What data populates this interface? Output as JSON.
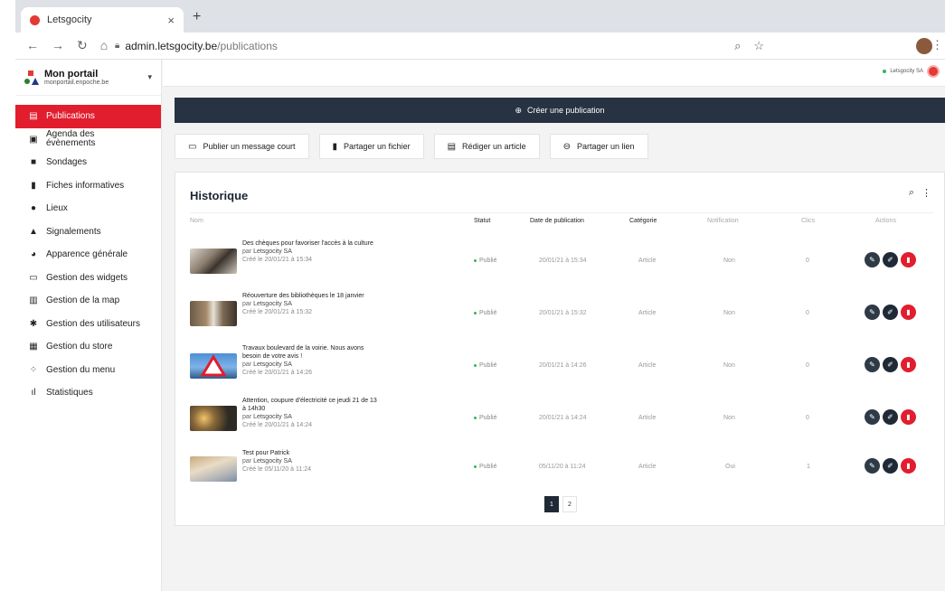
{
  "browser": {
    "tab_title": "Letsgocity",
    "tab_close": "×",
    "new_tab": "+",
    "url_host": "admin.letsgocity.be",
    "url_path": "/publications"
  },
  "portal": {
    "name": "Mon portail",
    "domain": "monportail.enpoche.be"
  },
  "account": {
    "name": "Letsgocity SA"
  },
  "sidebar": {
    "items": [
      {
        "label": "Publications",
        "icon": "list-icon"
      },
      {
        "label": "Agenda des évènements",
        "icon": "calendar-icon"
      },
      {
        "label": "Sondages",
        "icon": "chart-icon"
      },
      {
        "label": "Fiches informatives",
        "icon": "file-icon"
      },
      {
        "label": "Lieux",
        "icon": "pin-icon"
      },
      {
        "label": "Signalements",
        "icon": "warning-icon"
      },
      {
        "label": "Apparence générale",
        "icon": "palette-icon"
      },
      {
        "label": "Gestion des widgets",
        "icon": "widget-icon"
      },
      {
        "label": "Gestion de la map",
        "icon": "map-icon"
      },
      {
        "label": "Gestion des utilisateurs",
        "icon": "gear-icon"
      },
      {
        "label": "Gestion du store",
        "icon": "store-icon"
      },
      {
        "label": "Gestion du menu",
        "icon": "grid-icon"
      },
      {
        "label": "Statistiques",
        "icon": "bars-icon"
      }
    ]
  },
  "main": {
    "create_label": "Créer une publication",
    "actions": [
      {
        "label": "Publier un message court",
        "icon": "message-icon"
      },
      {
        "label": "Partager un fichier",
        "icon": "file-icon"
      },
      {
        "label": "Rédiger un article",
        "icon": "article-icon"
      },
      {
        "label": "Partager un lien",
        "icon": "link-icon"
      }
    ]
  },
  "history": {
    "title": "Historique",
    "columns": {
      "name": "Nom",
      "status": "Statut",
      "date": "Date de publication",
      "category": "Catégorie",
      "notification": "Notification",
      "clicks": "Clics",
      "actions": "Actions"
    },
    "rows": [
      {
        "title": "Des chèques pour favoriser l'accès à la culture",
        "author_prefix": "par",
        "author": "Letsgocity SA",
        "created": "Créé le 20/01/21 à 15:34",
        "status": "Publié",
        "date": "20/01/21 à 15:34",
        "category": "Article",
        "notification": "Non",
        "clicks": "0"
      },
      {
        "title": "Réouverture des bibliothèques le 18 janvier",
        "author_prefix": "par",
        "author": "Letsgocity SA",
        "created": "Créé le 20/01/21 à 15:32",
        "status": "Publié",
        "date": "20/01/21 à 15:32",
        "category": "Article",
        "notification": "Non",
        "clicks": "0"
      },
      {
        "title": "Travaux boulevard de la voirie. Nous avons besoin de votre avis !",
        "author_prefix": "par",
        "author": "Letsgocity SA",
        "created": "Créé le 20/01/21 à 14:26",
        "status": "Publié",
        "date": "20/01/21 à 14:26",
        "category": "Article",
        "notification": "Non",
        "clicks": "0"
      },
      {
        "title": "Attention, coupure d'électricité ce jeudi 21 de 13 à 14h30",
        "author_prefix": "par",
        "author": "Letsgocity SA",
        "created": "Créé le 20/01/21 à 14:24",
        "status": "Publié",
        "date": "20/01/21 à 14:24",
        "category": "Article",
        "notification": "Non",
        "clicks": "0"
      },
      {
        "title": "Test pour Patrick",
        "author_prefix": "par",
        "author": "Letsgocity SA",
        "created": "Créé le 05/11/20 à 11:24",
        "status": "Publié",
        "date": "05/11/20 à 11:24",
        "category": "Article",
        "notification": "Oui",
        "clicks": "1"
      }
    ],
    "pages": [
      "1",
      "2"
    ],
    "current_page": "1"
  },
  "colors": {
    "accent": "#e11d2e",
    "navy": "#273342",
    "published": "#2eb85c"
  }
}
